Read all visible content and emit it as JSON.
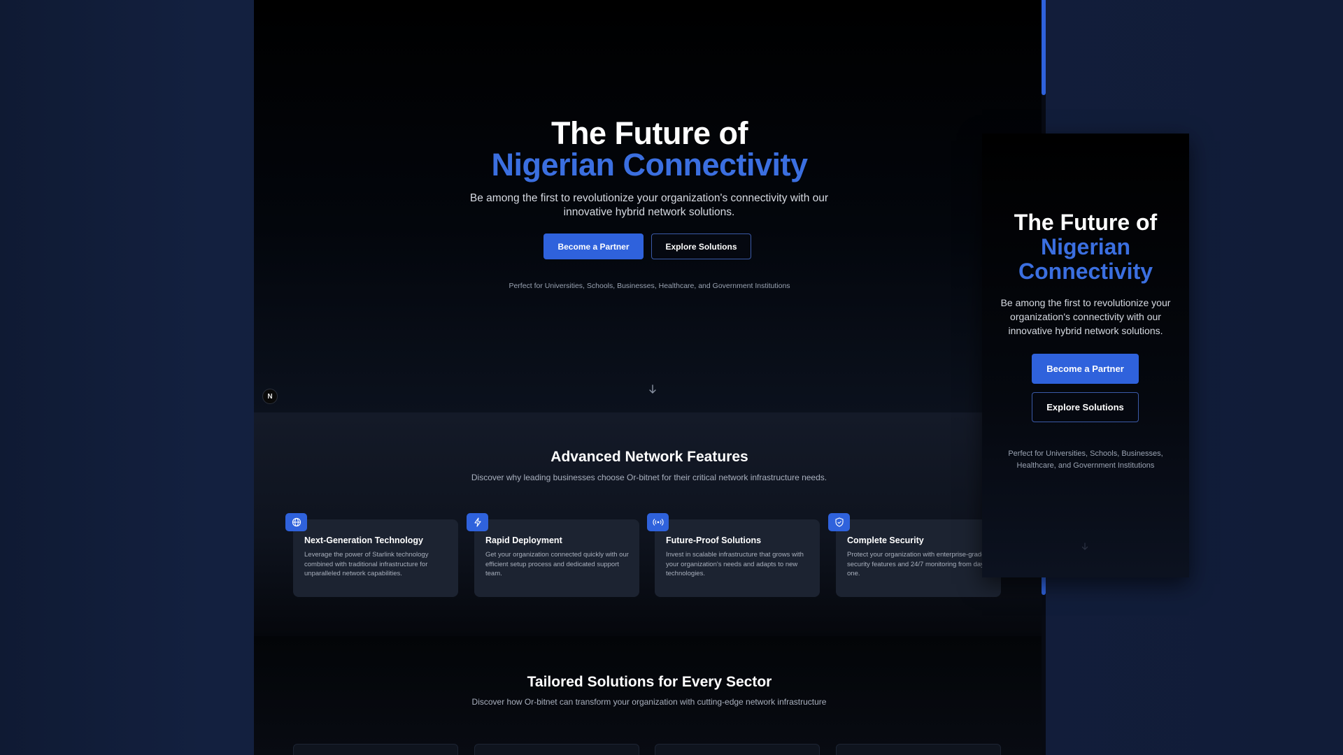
{
  "hero": {
    "title_line1": "The Future of",
    "title_line2": "Nigerian Connectivity",
    "subtitle": "Be among the first to revolutionize your organization's connectivity with our innovative hybrid network solutions.",
    "primary_button": "Become a Partner",
    "secondary_button": "Explore Solutions",
    "note": "Perfect for Universities, Schools, Businesses, Healthcare, and Government Institutions",
    "scroll_icon": "arrow-down-icon"
  },
  "nav_badge": {
    "label": "N"
  },
  "features": {
    "title": "Advanced Network Features",
    "subtitle": "Discover why leading businesses choose Or-bitnet for their critical network infrastructure needs.",
    "cards": [
      {
        "icon": "globe-icon",
        "title": "Next-Generation Technology",
        "text": "Leverage the power of Starlink technology combined with traditional infrastructure for unparalleled network capabilities."
      },
      {
        "icon": "lightning-icon",
        "title": "Rapid Deployment",
        "text": "Get your organization connected quickly with our efficient setup process and dedicated support team."
      },
      {
        "icon": "broadcast-icon",
        "title": "Future-Proof Solutions",
        "text": "Invest in scalable infrastructure that grows with your organization's needs and adapts to new technologies."
      },
      {
        "icon": "shield-check-icon",
        "title": "Complete Security",
        "text": "Protect your organization with enterprise-grade security features and 24/7 monitoring from day one."
      }
    ]
  },
  "solutions": {
    "title": "Tailored Solutions for Every Sector",
    "subtitle": "Discover how Or-bitnet can transform your organization with cutting-edge network infrastructure"
  },
  "mobile": {
    "title_line1": "The Future of",
    "title_line2a": "Nigerian",
    "title_line2b": "Connectivity",
    "subtitle": "Be among the first to revolutionize your organization's connectivity with our innovative hybrid network solutions.",
    "primary_button": "Become a Partner",
    "secondary_button": "Explore Solutions",
    "note": "Perfect for Universities, Schools, Businesses, Healthcare, and Government Institutions"
  },
  "colors": {
    "accent": "#2f62dc",
    "accent_text": "#3b6fe0",
    "background": "#111c38",
    "card": "#1c2331"
  }
}
